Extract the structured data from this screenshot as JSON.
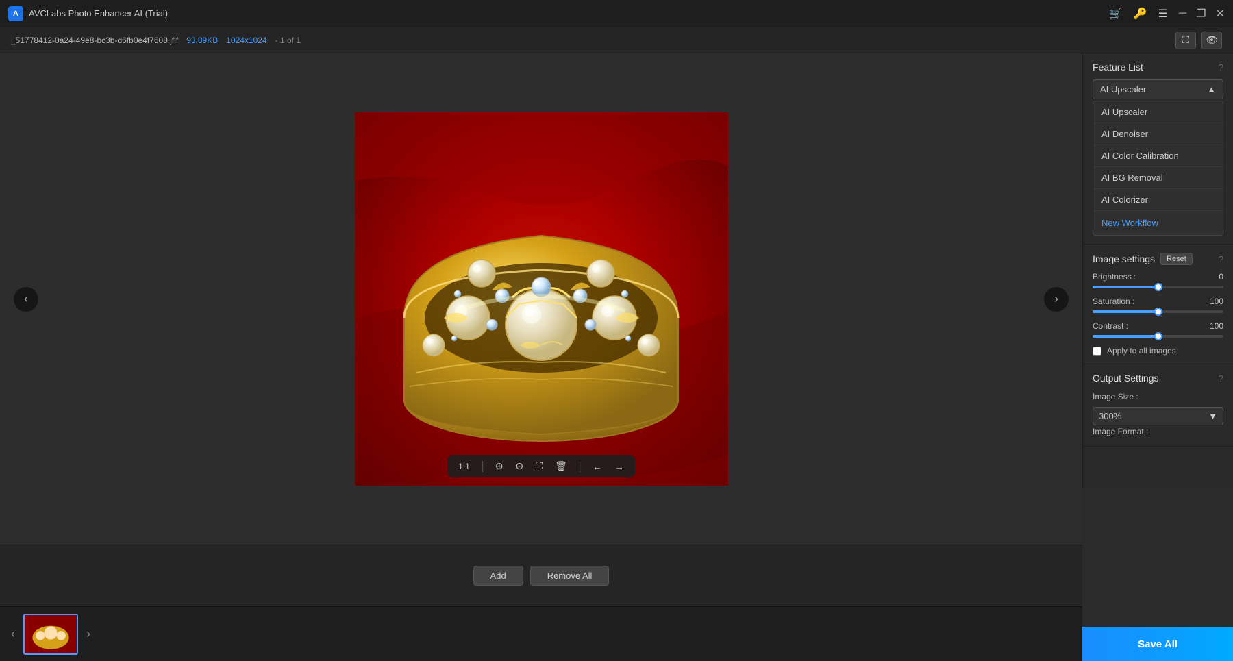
{
  "titleBar": {
    "appName": "AVCLabs Photo Enhancer AI (Trial)",
    "logoText": "A"
  },
  "fileBar": {
    "fileName": "_51778412-0a24-49e8-bc3b-d6fb0e4f7608.jfif",
    "fileSize": "93.89KB",
    "dimensions": "1024x1024",
    "count": "- 1 of 1"
  },
  "toolbar": {
    "ratio": "1:1",
    "zoomIn": "⊕",
    "zoomOut": "⊖",
    "crop": "⛶",
    "delete": "🗑",
    "prev": "←",
    "next": "→"
  },
  "featureList": {
    "title": "Feature List",
    "selected": "AI Upscaler",
    "items": [
      {
        "label": "AI Upscaler"
      },
      {
        "label": "AI Denoiser"
      },
      {
        "label": "AI Color Calibration"
      },
      {
        "label": "AI BG Removal"
      },
      {
        "label": "AI Colorizer"
      }
    ],
    "newWorkflow": "New Workflow"
  },
  "imageSettings": {
    "title": "Image settings",
    "resetLabel": "Reset",
    "brightness": {
      "label": "Brightness :",
      "value": "0",
      "percent": 50
    },
    "saturation": {
      "label": "Saturation :",
      "value": "100",
      "percent": 50
    },
    "contrast": {
      "label": "Contrast :",
      "value": "100",
      "percent": 50
    },
    "applyToAll": "Apply to all images"
  },
  "outputSettings": {
    "title": "Output Settings",
    "imageSizeLabel": "Image Size :",
    "imageSizeValue": "300%",
    "imageFormatLabel": "Image Format :"
  },
  "buttons": {
    "add": "Add",
    "removeAll": "Remove All",
    "saveAll": "Save All"
  }
}
